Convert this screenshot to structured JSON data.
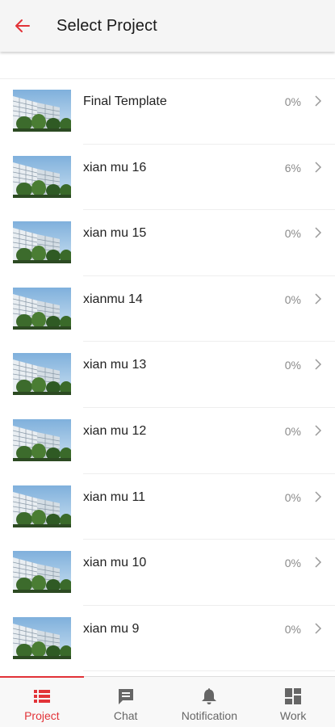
{
  "header": {
    "title": "Select Project",
    "back_icon": "arrow-left-icon",
    "accent_color": "#e23338"
  },
  "projects": [
    {
      "name": "Final Template",
      "progress": "0%"
    },
    {
      "name": "xian mu 16",
      "progress": "6%"
    },
    {
      "name": "xian mu 15",
      "progress": "0%"
    },
    {
      "name": "xianmu 14",
      "progress": "0%"
    },
    {
      "name": "xian mu 13",
      "progress": "0%"
    },
    {
      "name": "xian mu 12",
      "progress": "0%"
    },
    {
      "name": "xian mu 11",
      "progress": "0%"
    },
    {
      "name": "xian mu 10",
      "progress": "0%"
    },
    {
      "name": "xian mu 9",
      "progress": "0%"
    }
  ],
  "bottom_nav": {
    "items": [
      {
        "label": "Project",
        "icon": "list-icon",
        "active": true
      },
      {
        "label": "Chat",
        "icon": "chat-icon",
        "active": false
      },
      {
        "label": "Notification",
        "icon": "bell-icon",
        "active": false
      },
      {
        "label": "Work",
        "icon": "grid-icon",
        "active": false
      }
    ]
  }
}
